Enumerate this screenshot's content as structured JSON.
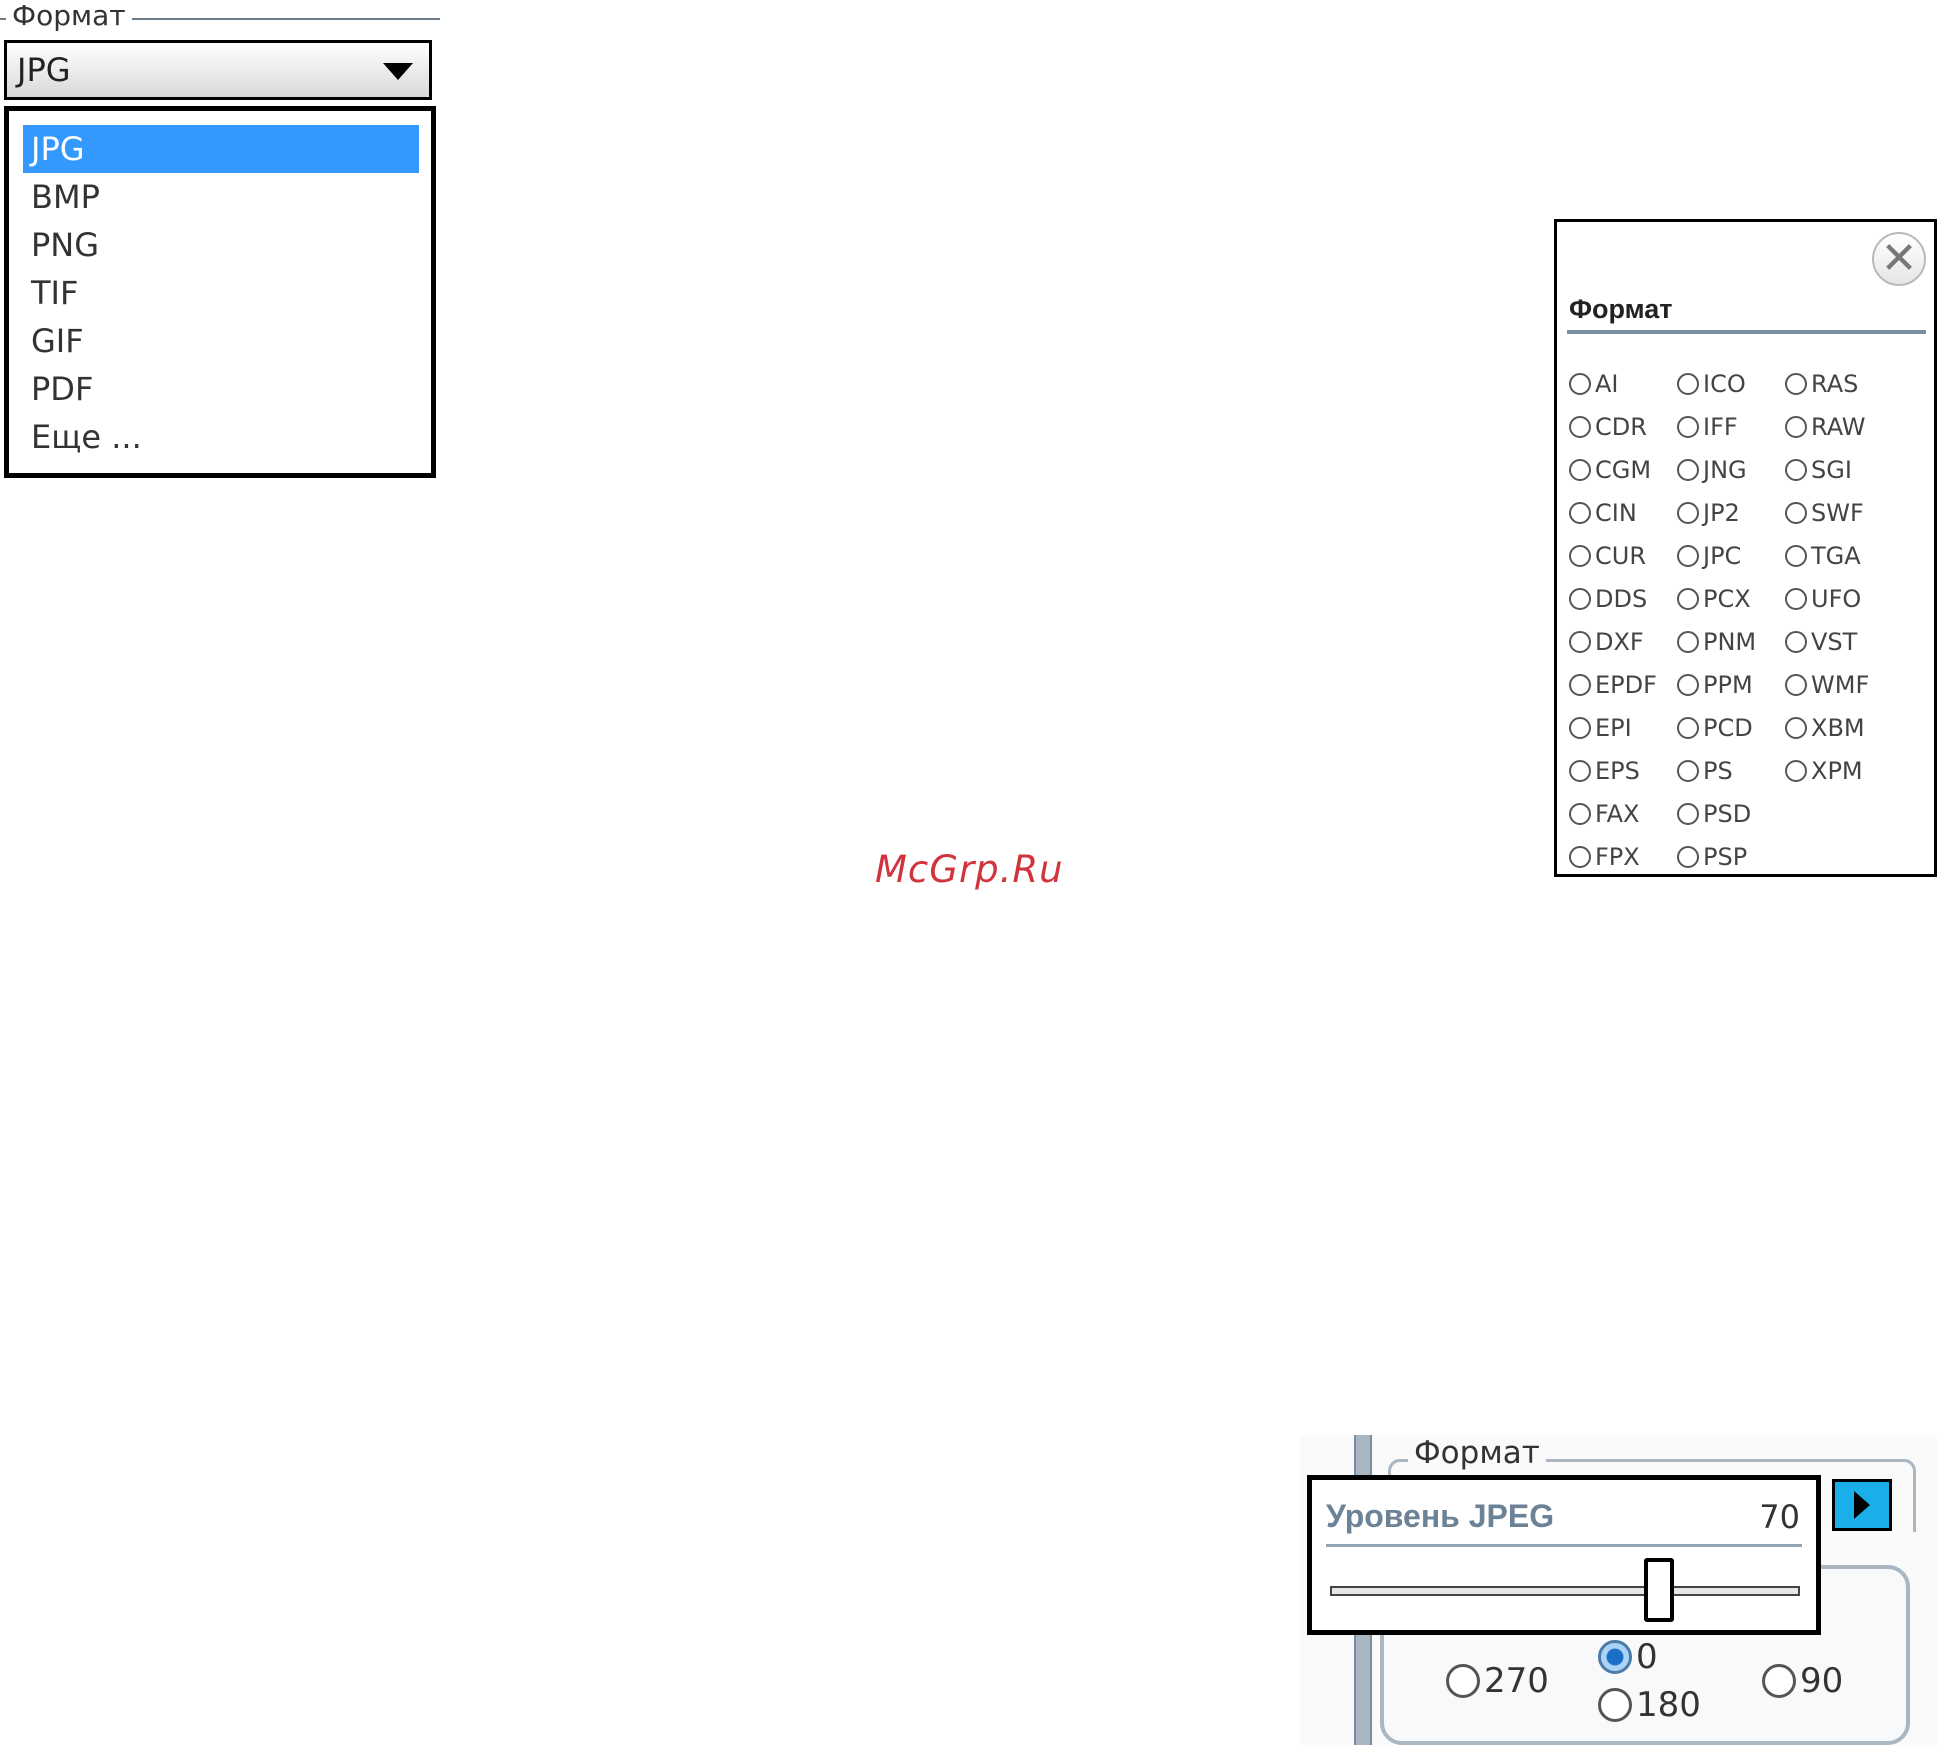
{
  "dropdown_panel": {
    "group_label": "Формат",
    "selected_value": "JPG",
    "options": [
      {
        "label": "JPG",
        "selected": true
      },
      {
        "label": "BMP",
        "selected": false
      },
      {
        "label": "PNG",
        "selected": false
      },
      {
        "label": "TIF",
        "selected": false
      },
      {
        "label": "GIF",
        "selected": false
      },
      {
        "label": "PDF",
        "selected": false
      },
      {
        "label": "Еще ...",
        "selected": false
      }
    ]
  },
  "format_dialog": {
    "title": "Формат",
    "close_icon": "close-icon",
    "columns": [
      [
        "AI",
        "CDR",
        "CGM",
        "CIN",
        "CUR",
        "DDS",
        "DXF",
        "EPDF",
        "EPI",
        "EPS",
        "FAX",
        "FPX"
      ],
      [
        "ICO",
        "IFF",
        "JNG",
        "JP2",
        "JPC",
        "PCX",
        "PNM",
        "PPM",
        "PCD",
        "PS",
        "PSD",
        "PSP"
      ],
      [
        "RAS",
        "RAW",
        "SGI",
        "SWF",
        "TGA",
        "UFO",
        "VST",
        "WMF",
        "XBM",
        "XPM"
      ]
    ]
  },
  "watermark": "McGrp.Ru",
  "jpeg_panel": {
    "group_label": "Формат",
    "level_label": "Уровень JPEG",
    "level_value": "70",
    "slider_fraction": 0.7,
    "rotation_options": [
      {
        "label": "270",
        "checked": false
      },
      {
        "label": "0",
        "checked": true
      },
      {
        "label": "180",
        "checked": false
      },
      {
        "label": "90",
        "checked": false
      }
    ]
  },
  "colors": {
    "selection": "#3399ff",
    "watermark": "#d0343c",
    "arrow_button": "#1aaeea"
  }
}
